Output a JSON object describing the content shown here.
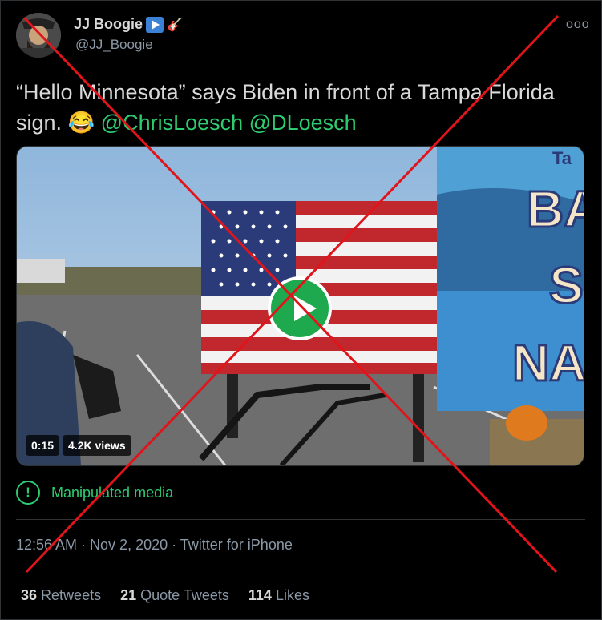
{
  "author": {
    "name": "JJ Boogie",
    "handle": "@JJ_Boogie",
    "badge_emoji": "🎸"
  },
  "more_label": "ooo",
  "tweet": {
    "text": "“Hello Minnesota” says Biden in front of a Tampa Florida sign. 😂",
    "mentions": [
      "@ChrisLoesch",
      "@DLoesch"
    ]
  },
  "media": {
    "duration": "0:15",
    "views": "4.2K views",
    "sign_text": [
      "Ta",
      "BA",
      "S",
      "NA"
    ]
  },
  "label": {
    "text": "Manipulated media",
    "icon": "!"
  },
  "meta": {
    "timestamp": "12:56 AM · Nov 2, 2020 · Twitter for iPhone"
  },
  "stats": [
    {
      "count": "36",
      "label": "Retweets"
    },
    {
      "count": "21",
      "label": "Quote Tweets"
    },
    {
      "count": "114",
      "label": "Likes"
    }
  ],
  "colors": {
    "accent_green": "#2ecc71",
    "cross_red": "#e0151b",
    "background": "#000000"
  }
}
